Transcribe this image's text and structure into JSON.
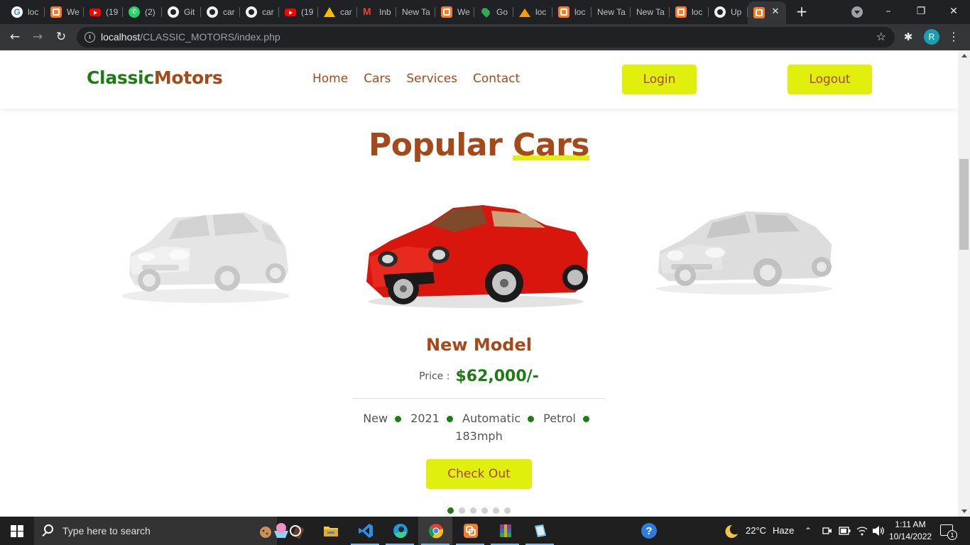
{
  "browser": {
    "tabs": [
      {
        "title": "loc",
        "icon": "google-icon"
      },
      {
        "title": "We",
        "icon": "xampp-icon"
      },
      {
        "title": "(19",
        "icon": "youtube-icon"
      },
      {
        "title": "(2)",
        "icon": "whatsapp-icon"
      },
      {
        "title": "Git",
        "icon": "github-icon"
      },
      {
        "title": "car",
        "icon": "github-icon"
      },
      {
        "title": "car",
        "icon": "github-icon"
      },
      {
        "title": "(19",
        "icon": "youtube-icon"
      },
      {
        "title": "car",
        "icon": "google-drive-icon"
      },
      {
        "title": "Inb",
        "icon": "gmail-icon"
      },
      {
        "title": "New Ta",
        "icon": ""
      },
      {
        "title": "We",
        "icon": "xampp-icon"
      },
      {
        "title": "Go",
        "icon": "google-maps-icon"
      },
      {
        "title": "loc",
        "icon": "phpmyadmin-icon"
      },
      {
        "title": "loc",
        "icon": "xampp-icon"
      },
      {
        "title": "New Ta",
        "icon": ""
      },
      {
        "title": "New Ta",
        "icon": ""
      },
      {
        "title": "loc",
        "icon": "xampp-icon"
      },
      {
        "title": "Up",
        "icon": "github-icon"
      },
      {
        "title": "",
        "icon": "xampp-icon",
        "active": true
      }
    ],
    "new_tab_symbol": "+",
    "address": {
      "host": "localhost",
      "path": "/CLASSIC_MOTORS/index.php"
    },
    "profile_initial": "R",
    "window_controls": {
      "minimize": "–",
      "restore": "❐",
      "close": "✕"
    }
  },
  "site": {
    "logo_part1": "Classic",
    "logo_part2": "Motors",
    "nav": [
      "Home",
      "Cars",
      "Services",
      "Contact"
    ],
    "login_label": "Login",
    "logout_label": "Logout",
    "section_title_part1": "Popular",
    "section_title_part2": "Cars",
    "card": {
      "title": "New Model",
      "price_label": "Price :",
      "price_value": "$62,000/-",
      "specs": [
        "New",
        "2021",
        "Automatic",
        "Petrol",
        "183mph"
      ],
      "cta_label": "Check Out"
    },
    "carousel": {
      "slide_count": 6,
      "active_index": 0
    },
    "colors": {
      "brand_green": "#1d7d14",
      "brand_brown": "#a6491a",
      "accent_yellow": "#e1ef0c"
    }
  },
  "taskbar": {
    "search_placeholder": "Type here to search",
    "apps": [
      "file-explorer-icon",
      "vscode-icon",
      "edge-icon",
      "chrome-icon",
      "xampp-icon",
      "winrar-icon",
      "notepad-icon"
    ],
    "weather": {
      "temp": "22°C",
      "condition": "Haze"
    },
    "clock_time": "1:11 AM",
    "clock_date": "10/14/2022",
    "notification_count": "1"
  }
}
